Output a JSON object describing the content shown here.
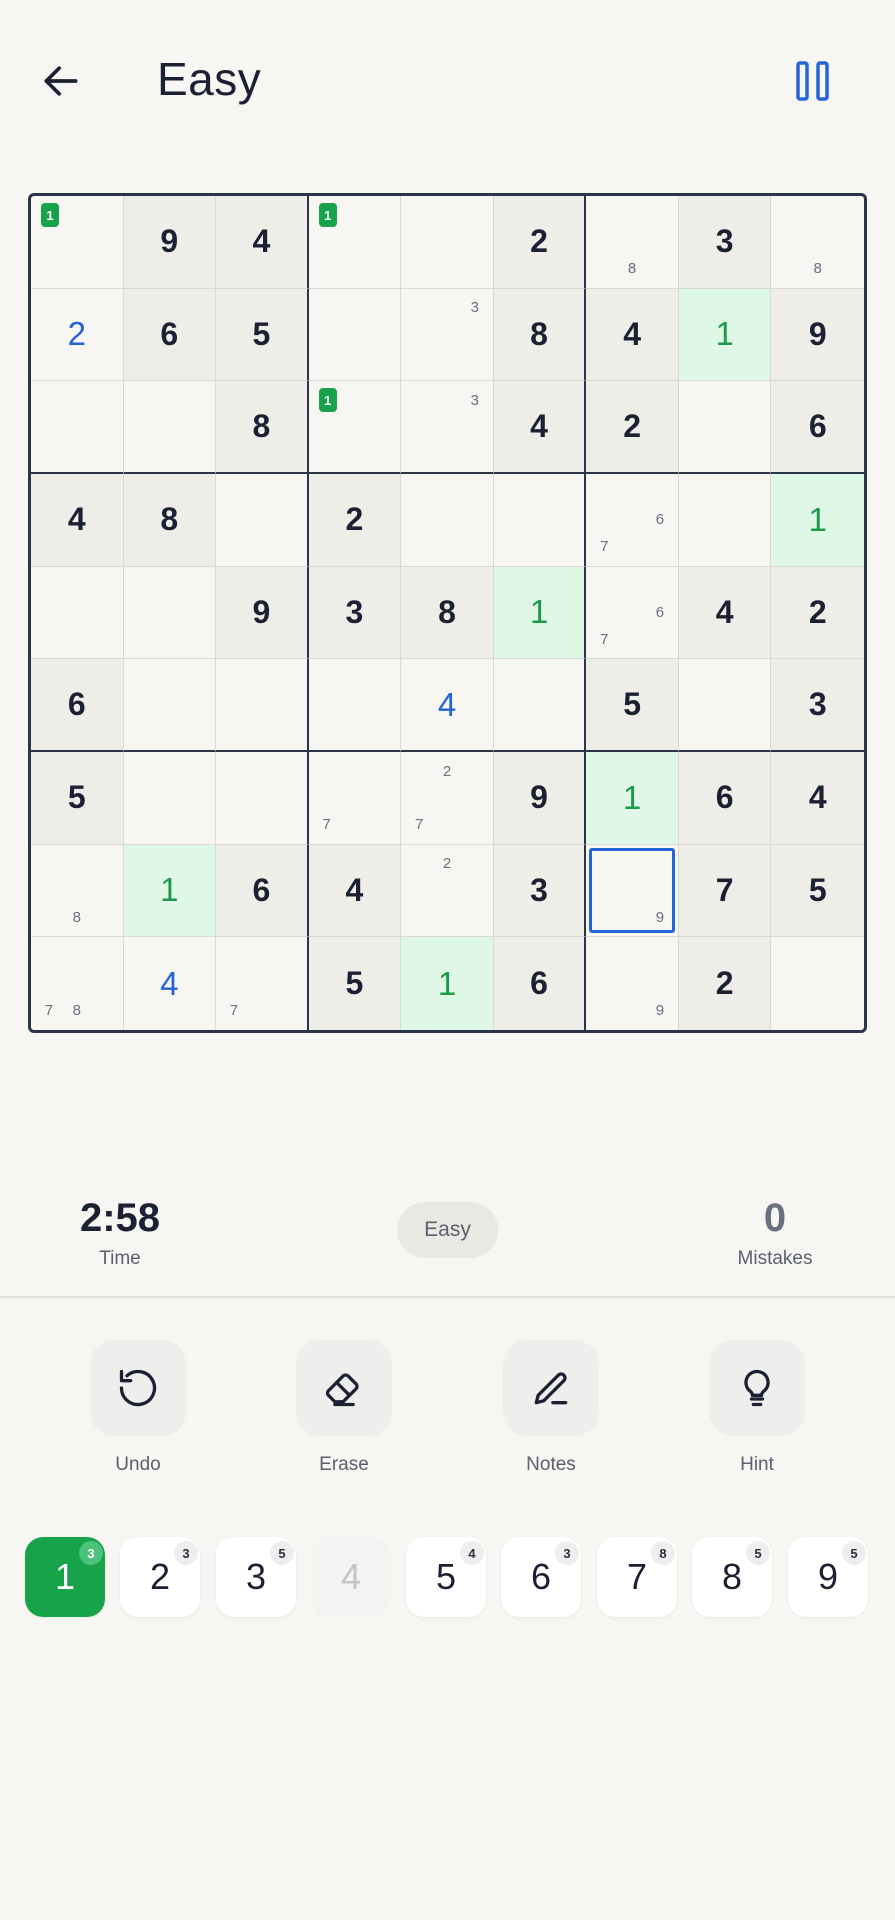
{
  "header": {
    "title": "Easy"
  },
  "board": [
    [
      {
        "v": "",
        "t": "empty",
        "n": [
          {
            "d": "1",
            "p": 0,
            "b": true
          }
        ]
      },
      {
        "v": "9",
        "t": "given"
      },
      {
        "v": "4",
        "t": "given"
      },
      {
        "v": "",
        "t": "empty",
        "n": [
          {
            "d": "1",
            "p": 0,
            "b": true
          }
        ]
      },
      {
        "v": "",
        "t": "empty"
      },
      {
        "v": "2",
        "t": "given"
      },
      {
        "v": "",
        "t": "empty",
        "n": [
          {
            "d": "8",
            "p": 7
          }
        ]
      },
      {
        "v": "3",
        "t": "given"
      },
      {
        "v": "",
        "t": "empty",
        "n": [
          {
            "d": "8",
            "p": 7
          }
        ]
      }
    ],
    [
      {
        "v": "2",
        "t": "user"
      },
      {
        "v": "6",
        "t": "given"
      },
      {
        "v": "5",
        "t": "given"
      },
      {
        "v": "",
        "t": "empty"
      },
      {
        "v": "",
        "t": "empty",
        "n": [
          {
            "d": "3",
            "p": 2
          }
        ]
      },
      {
        "v": "8",
        "t": "given"
      },
      {
        "v": "4",
        "t": "given"
      },
      {
        "v": "1",
        "t": "hl"
      },
      {
        "v": "9",
        "t": "given"
      }
    ],
    [
      {
        "v": "",
        "t": "empty"
      },
      {
        "v": "",
        "t": "empty"
      },
      {
        "v": "8",
        "t": "given"
      },
      {
        "v": "",
        "t": "empty",
        "n": [
          {
            "d": "1",
            "p": 0,
            "b": true
          }
        ]
      },
      {
        "v": "",
        "t": "empty",
        "n": [
          {
            "d": "3",
            "p": 2
          }
        ]
      },
      {
        "v": "4",
        "t": "given"
      },
      {
        "v": "2",
        "t": "given"
      },
      {
        "v": "",
        "t": "empty"
      },
      {
        "v": "6",
        "t": "given"
      }
    ],
    [
      {
        "v": "4",
        "t": "given"
      },
      {
        "v": "8",
        "t": "given"
      },
      {
        "v": "",
        "t": "empty"
      },
      {
        "v": "2",
        "t": "given"
      },
      {
        "v": "",
        "t": "empty"
      },
      {
        "v": "",
        "t": "empty"
      },
      {
        "v": "",
        "t": "empty",
        "n": [
          {
            "d": "6",
            "p": 5
          },
          {
            "d": "7",
            "p": 6
          }
        ]
      },
      {
        "v": "",
        "t": "empty"
      },
      {
        "v": "1",
        "t": "hl"
      }
    ],
    [
      {
        "v": "",
        "t": "empty"
      },
      {
        "v": "",
        "t": "empty"
      },
      {
        "v": "9",
        "t": "given"
      },
      {
        "v": "3",
        "t": "given"
      },
      {
        "v": "8",
        "t": "given"
      },
      {
        "v": "1",
        "t": "hl"
      },
      {
        "v": "",
        "t": "empty",
        "n": [
          {
            "d": "6",
            "p": 5
          },
          {
            "d": "7",
            "p": 6
          }
        ]
      },
      {
        "v": "4",
        "t": "given"
      },
      {
        "v": "2",
        "t": "given"
      }
    ],
    [
      {
        "v": "6",
        "t": "given"
      },
      {
        "v": "",
        "t": "empty"
      },
      {
        "v": "",
        "t": "empty"
      },
      {
        "v": "",
        "t": "empty"
      },
      {
        "v": "4",
        "t": "user"
      },
      {
        "v": "",
        "t": "empty"
      },
      {
        "v": "5",
        "t": "given"
      },
      {
        "v": "",
        "t": "empty"
      },
      {
        "v": "3",
        "t": "given"
      }
    ],
    [
      {
        "v": "5",
        "t": "given"
      },
      {
        "v": "",
        "t": "empty"
      },
      {
        "v": "",
        "t": "empty"
      },
      {
        "v": "",
        "t": "empty",
        "n": [
          {
            "d": "7",
            "p": 6
          }
        ]
      },
      {
        "v": "",
        "t": "empty",
        "n": [
          {
            "d": "2",
            "p": 1
          },
          {
            "d": "7",
            "p": 6
          }
        ]
      },
      {
        "v": "9",
        "t": "given"
      },
      {
        "v": "1",
        "t": "hl"
      },
      {
        "v": "6",
        "t": "given"
      },
      {
        "v": "4",
        "t": "given"
      }
    ],
    [
      {
        "v": "",
        "t": "empty",
        "n": [
          {
            "d": "8",
            "p": 7
          }
        ]
      },
      {
        "v": "1",
        "t": "hl"
      },
      {
        "v": "6",
        "t": "given"
      },
      {
        "v": "4",
        "t": "given"
      },
      {
        "v": "",
        "t": "empty",
        "n": [
          {
            "d": "2",
            "p": 1
          }
        ]
      },
      {
        "v": "3",
        "t": "given"
      },
      {
        "v": "",
        "t": "empty",
        "sel": true,
        "n": [
          {
            "d": "9",
            "p": 8
          }
        ]
      },
      {
        "v": "7",
        "t": "given"
      },
      {
        "v": "5",
        "t": "given"
      }
    ],
    [
      {
        "v": "",
        "t": "empty",
        "n": [
          {
            "d": "7",
            "p": 6
          },
          {
            "d": "8",
            "p": 7
          }
        ]
      },
      {
        "v": "4",
        "t": "user"
      },
      {
        "v": "",
        "t": "empty",
        "n": [
          {
            "d": "7",
            "p": 6
          }
        ]
      },
      {
        "v": "5",
        "t": "given"
      },
      {
        "v": "1",
        "t": "hl"
      },
      {
        "v": "6",
        "t": "given"
      },
      {
        "v": "",
        "t": "empty",
        "n": [
          {
            "d": "9",
            "p": 8
          }
        ]
      },
      {
        "v": "2",
        "t": "given"
      },
      {
        "v": "",
        "t": "empty"
      }
    ]
  ],
  "stats": {
    "time": "2:58",
    "time_label": "Time",
    "difficulty": "Easy",
    "mistakes": "0",
    "mistakes_label": "Mistakes"
  },
  "tools": [
    {
      "label": "Undo",
      "icon": "undo-icon"
    },
    {
      "label": "Erase",
      "icon": "eraser-icon"
    },
    {
      "label": "Notes",
      "icon": "pencil-icon"
    },
    {
      "label": "Hint",
      "icon": "lightbulb-icon"
    }
  ],
  "numbers": [
    {
      "digit": "1",
      "count": "3",
      "state": "active"
    },
    {
      "digit": "2",
      "count": "3",
      "state": "normal"
    },
    {
      "digit": "3",
      "count": "5",
      "state": "normal"
    },
    {
      "digit": "4",
      "count": "",
      "state": "used"
    },
    {
      "digit": "5",
      "count": "4",
      "state": "normal"
    },
    {
      "digit": "6",
      "count": "3",
      "state": "normal"
    },
    {
      "digit": "7",
      "count": "8",
      "state": "normal"
    },
    {
      "digit": "8",
      "count": "5",
      "state": "normal"
    },
    {
      "digit": "9",
      "count": "5",
      "state": "normal"
    }
  ],
  "colors": {
    "accent_blue": "#2563d9",
    "accent_green": "#16a34a",
    "highlight_green": "#dff8e6",
    "grid_border": "#2c3447"
  }
}
